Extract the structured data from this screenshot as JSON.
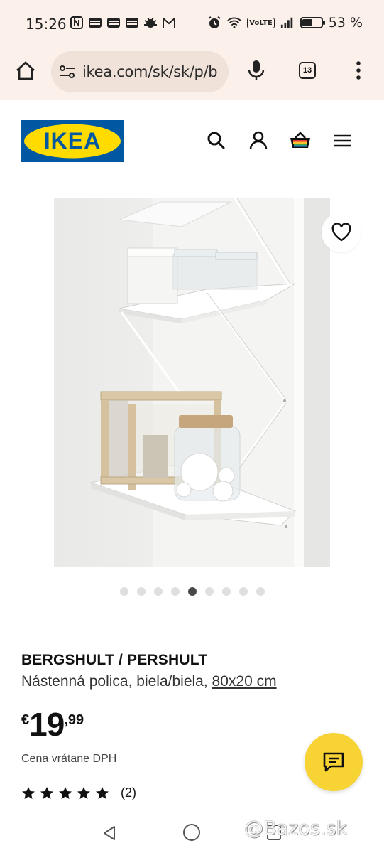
{
  "status_bar": {
    "time": "15:26",
    "battery_percent": "53 %",
    "battery_level": 0.53,
    "network": "VoLTE",
    "icons_left": [
      "nfc-icon",
      "mail-icon",
      "mail-icon",
      "mail-icon",
      "bug-icon",
      "gmail-icon"
    ],
    "icons_right": [
      "alarm-icon",
      "wifi-icon",
      "volte-icon",
      "signal-icon",
      "battery-icon"
    ]
  },
  "browser": {
    "url": "ikea.com/sk/sk/p/b",
    "tab_count": "13"
  },
  "header": {
    "logo_text": "IKEA",
    "logo_colors": {
      "blue": "#0058a3",
      "yellow": "#ffdb00"
    }
  },
  "carousel": {
    "total": 9,
    "active_index": 4
  },
  "product": {
    "name": "BERGSHULT / PERSHULT",
    "description": "Nástenná polica, biela/biela,",
    "size": "80x20 cm",
    "price": {
      "currency": "€",
      "integer": "19",
      "decimal": ",99"
    },
    "vat_note": "Cena vrátane DPH",
    "rating_stars": 5,
    "rating_count": "(2)"
  },
  "colors": {
    "chrome_bg": "#fbf1ea",
    "chat_fab": "#f7d334"
  },
  "watermark": "@Bazos.sk"
}
